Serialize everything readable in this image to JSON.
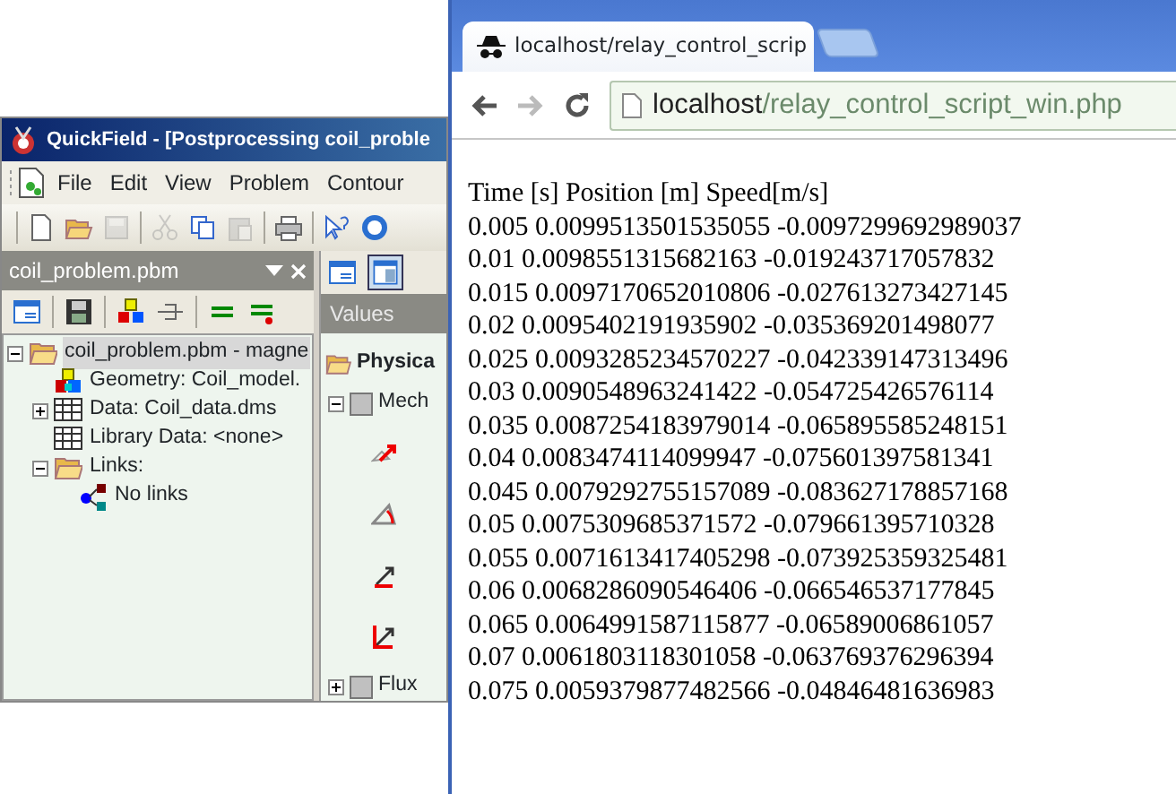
{
  "quickfield": {
    "title": "QuickField - [Postprocessing coil_proble",
    "menu": [
      "File",
      "Edit",
      "View",
      "Problem",
      "Contour"
    ],
    "toolbar": [
      {
        "kind": "new",
        "disabled": false
      },
      {
        "kind": "open",
        "disabled": false
      },
      {
        "kind": "save",
        "disabled": true
      },
      {
        "kind": "sep"
      },
      {
        "kind": "cut",
        "disabled": true
      },
      {
        "kind": "copy",
        "disabled": false
      },
      {
        "kind": "paste",
        "disabled": true
      },
      {
        "kind": "sep"
      },
      {
        "kind": "print",
        "disabled": false
      },
      {
        "kind": "sep"
      },
      {
        "kind": "whatsthis",
        "disabled": false
      },
      {
        "kind": "help",
        "disabled": false
      }
    ],
    "panel": {
      "title": "coil_problem.pbm",
      "tree": [
        {
          "label": "coil_problem.pbm - magne",
          "kind": "folder",
          "expanded": true,
          "selected": true,
          "children": [
            {
              "label": "Geometry: Coil_model.",
              "kind": "geometry",
              "selected": false
            },
            {
              "label": "Data: Coil_data.dms",
              "kind": "table",
              "expanded": false,
              "selected": false
            },
            {
              "label": "Library Data: <none>",
              "kind": "table",
              "selected": false
            },
            {
              "label": "Links:",
              "kind": "folder",
              "expanded": true,
              "selected": false,
              "children": [
                {
                  "label": "No links",
                  "kind": "links",
                  "selected": false
                }
              ]
            }
          ]
        }
      ]
    },
    "values": {
      "title": "Values",
      "header": "Physica",
      "groups": [
        {
          "label": "Mech",
          "expanded": true,
          "items": [
            {
              "kind": "force"
            },
            {
              "kind": "angle"
            },
            {
              "kind": "arrow"
            },
            {
              "kind": "arrow-red"
            }
          ]
        },
        {
          "label": "Flux",
          "expanded": false
        }
      ]
    }
  },
  "browser": {
    "tab_title": "localhost/relay_control_scrip",
    "url_host": "localhost",
    "url_path": "/relay_control_script_win.php",
    "lines": [
      "Time [s] Position [m] Speed[m/s]",
      "0.005 0.0099513501535055 -0.0097299692989037",
      "0.01 0.0098551315682163 -0.019243717057832",
      "0.015 0.0097170652010806 -0.027613273427145",
      "0.02 0.0095402191935902 -0.035369201498077",
      "0.025 0.0093285234570227 -0.042339147313496",
      "0.03 0.0090548963241422 -0.054725426576114",
      "0.035 0.0087254183979014 -0.065895585248151",
      "0.04 0.0083474114099947 -0.075601397581341",
      "0.045 0.0079292755157089 -0.083627178857168",
      "0.05 0.0075309685371572 -0.079661395710328",
      "0.055 0.0071613417405298 -0.073925359325481",
      "0.06 0.0068286090546406 -0.066546537177845",
      "0.065 0.0064991587115877 -0.06589006861057",
      "0.07 0.0061803118301058 -0.063769376296394",
      "0.075 0.0059379877482566 -0.04846481636983"
    ]
  }
}
